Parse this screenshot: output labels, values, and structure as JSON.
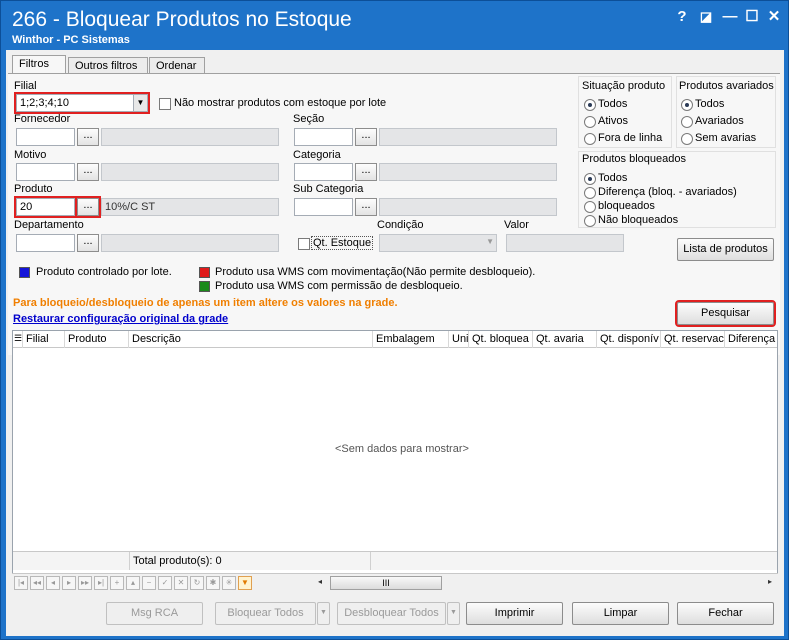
{
  "window": {
    "title": "266 - Bloquear Produtos no Estoque",
    "subtitle": "Winthor - PC Sistemas",
    "help": "?",
    "restore": "◪",
    "minimize": "—",
    "maximize": "☐",
    "close": "✕"
  },
  "tabs": [
    "Filtros",
    "Outros filtros",
    "Ordenar"
  ],
  "filters": {
    "filial_label": "Filial",
    "filial_value": "1;2;3;4;10",
    "no_show_lote_label": "Não mostrar produtos com estoque por lote",
    "fornecedor_label": "Fornecedor",
    "secao_label": "Seção",
    "motivo_label": "Motivo",
    "categoria_label": "Categoria",
    "produto_label": "Produto",
    "produto_value": "20",
    "produto_desc": "10%/C ST",
    "subcategoria_label": "Sub Categoria",
    "departamento_label": "Departamento",
    "qt_estoque_label": "Qt. Estoque",
    "condicao_label": "Condição",
    "valor_label": "Valor",
    "dots": "..."
  },
  "situacao": {
    "title": "Situação produto",
    "options": [
      "Todos",
      "Ativos",
      "Fora de linha"
    ]
  },
  "avariados": {
    "title": "Produtos avariados",
    "options": [
      "Todos",
      "Avariados",
      "Sem avarias"
    ]
  },
  "bloqueados": {
    "title": "Produtos bloqueados",
    "options": [
      "Todos",
      "Diferença (bloq. - avariados)",
      "bloqueados",
      "Não bloqueados"
    ]
  },
  "buttons": {
    "lista_produtos": "Lista de produtos",
    "pesquisar": "Pesquisar",
    "msg_rca": "Msg RCA",
    "bloquear_todos": "Bloquear Todos",
    "desbloquear_todos": "Desbloquear Todos",
    "imprimir": "Imprimir",
    "limpar": "Limpar",
    "fechar": "Fechar"
  },
  "legend": {
    "lote": "Produto controlado por lote.",
    "wms_mov": "Produto usa WMS com movimentação(Não permite desbloqueio).",
    "wms_perm": "Produto usa WMS com permissão de desbloqueio.",
    "colors": {
      "lote": "#1414d8",
      "wms_mov": "#e01b1b",
      "wms_perm": "#1b8a1b"
    }
  },
  "info": {
    "warning": "Para bloqueio/desbloqueio de apenas um item altere os valores na grade.",
    "restore_link": "Restaurar configuração original da grade"
  },
  "grid": {
    "columns": [
      "Filial",
      "Produto",
      "Descrição",
      "Embalagem",
      "Uni",
      "Qt. bloquea",
      "Qt. avaria",
      "Qt. disponív",
      "Qt. reservac",
      "Diferença ("
    ],
    "empty_text": "<Sem dados para mostrar>",
    "total_label": "Total produto(s): 0"
  },
  "nav_icons": [
    "first-icon",
    "prev-page-icon",
    "prev-icon",
    "next-icon",
    "next-page-icon",
    "last-icon",
    "insert-icon",
    "up-icon",
    "delete-icon",
    "post-icon",
    "cancel-icon",
    "refresh-icon",
    "bookmark-icon",
    "goto-bookmark-icon",
    "filter-icon"
  ],
  "scrollbar_grip": "III",
  "colors": {
    "title_bar": "#1e73c9",
    "warning_text": "#f07f00",
    "link": "#0000cc",
    "highlight": "#e02020"
  }
}
